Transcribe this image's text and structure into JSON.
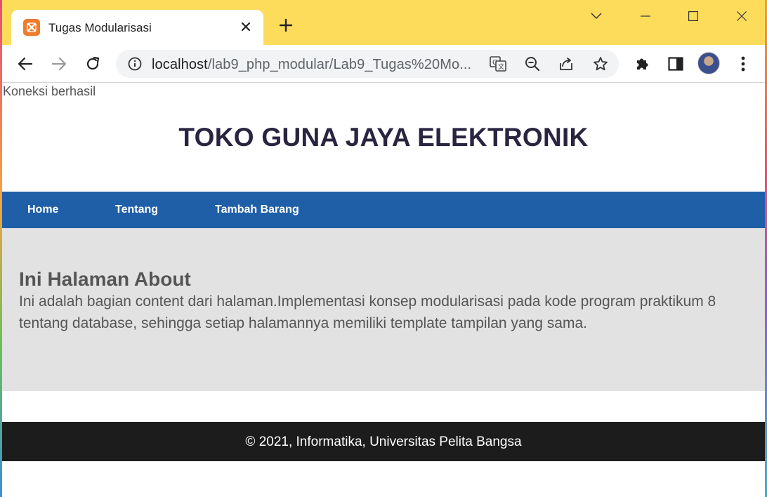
{
  "browser": {
    "tab": {
      "title": "Tugas Modularisasi",
      "favicon": "xampp-icon",
      "close_icon": "close-icon"
    },
    "new_tab_icon": "plus-icon",
    "window_controls": [
      "chevron-down-icon",
      "minimize-icon",
      "maximize-icon",
      "close-icon"
    ],
    "toolbar": {
      "back_icon": "back-arrow-icon",
      "forward_icon": "forward-arrow-icon",
      "reload_icon": "reload-icon",
      "site_info_icon": "info-icon",
      "url_host": "localhost",
      "url_path": "/lab9_php_modular/Lab9_Tugas%20Mo...",
      "translate_icon": "translate-icon",
      "zoom_icon": "zoom-out-icon",
      "share_icon": "share-icon",
      "bookmark_icon": "star-icon",
      "extensions_icon": "puzzle-icon",
      "sidepanel_icon": "side-panel-icon",
      "profile_icon": "avatar",
      "menu_icon": "kebab-menu-icon"
    },
    "colors": {
      "tabstrip": "#fddc5c",
      "favicon": "#f07c2b"
    }
  },
  "page": {
    "connection_status": "Koneksi berhasil",
    "header_title": "TOKO GUNA JAYA ELEKTRONIK",
    "nav": [
      {
        "label": "Home"
      },
      {
        "label": "Tentang"
      },
      {
        "label": "Tambah Barang"
      }
    ],
    "content": {
      "heading": "Ini Halaman About",
      "body": "Ini adalah bagian content dari halaman.Implementasi konsep modularisasi pada kode program praktikum 8 tentang database, sehingga setiap halamannya memiliki template tampilan yang sama."
    },
    "footer": "© 2021, Informatika, Universitas Pelita Bangsa",
    "colors": {
      "nav_bg": "#1f5fa8",
      "content_bg": "#e2e2e2",
      "footer_bg": "#1c1c1c",
      "title": "#2a2440"
    }
  }
}
